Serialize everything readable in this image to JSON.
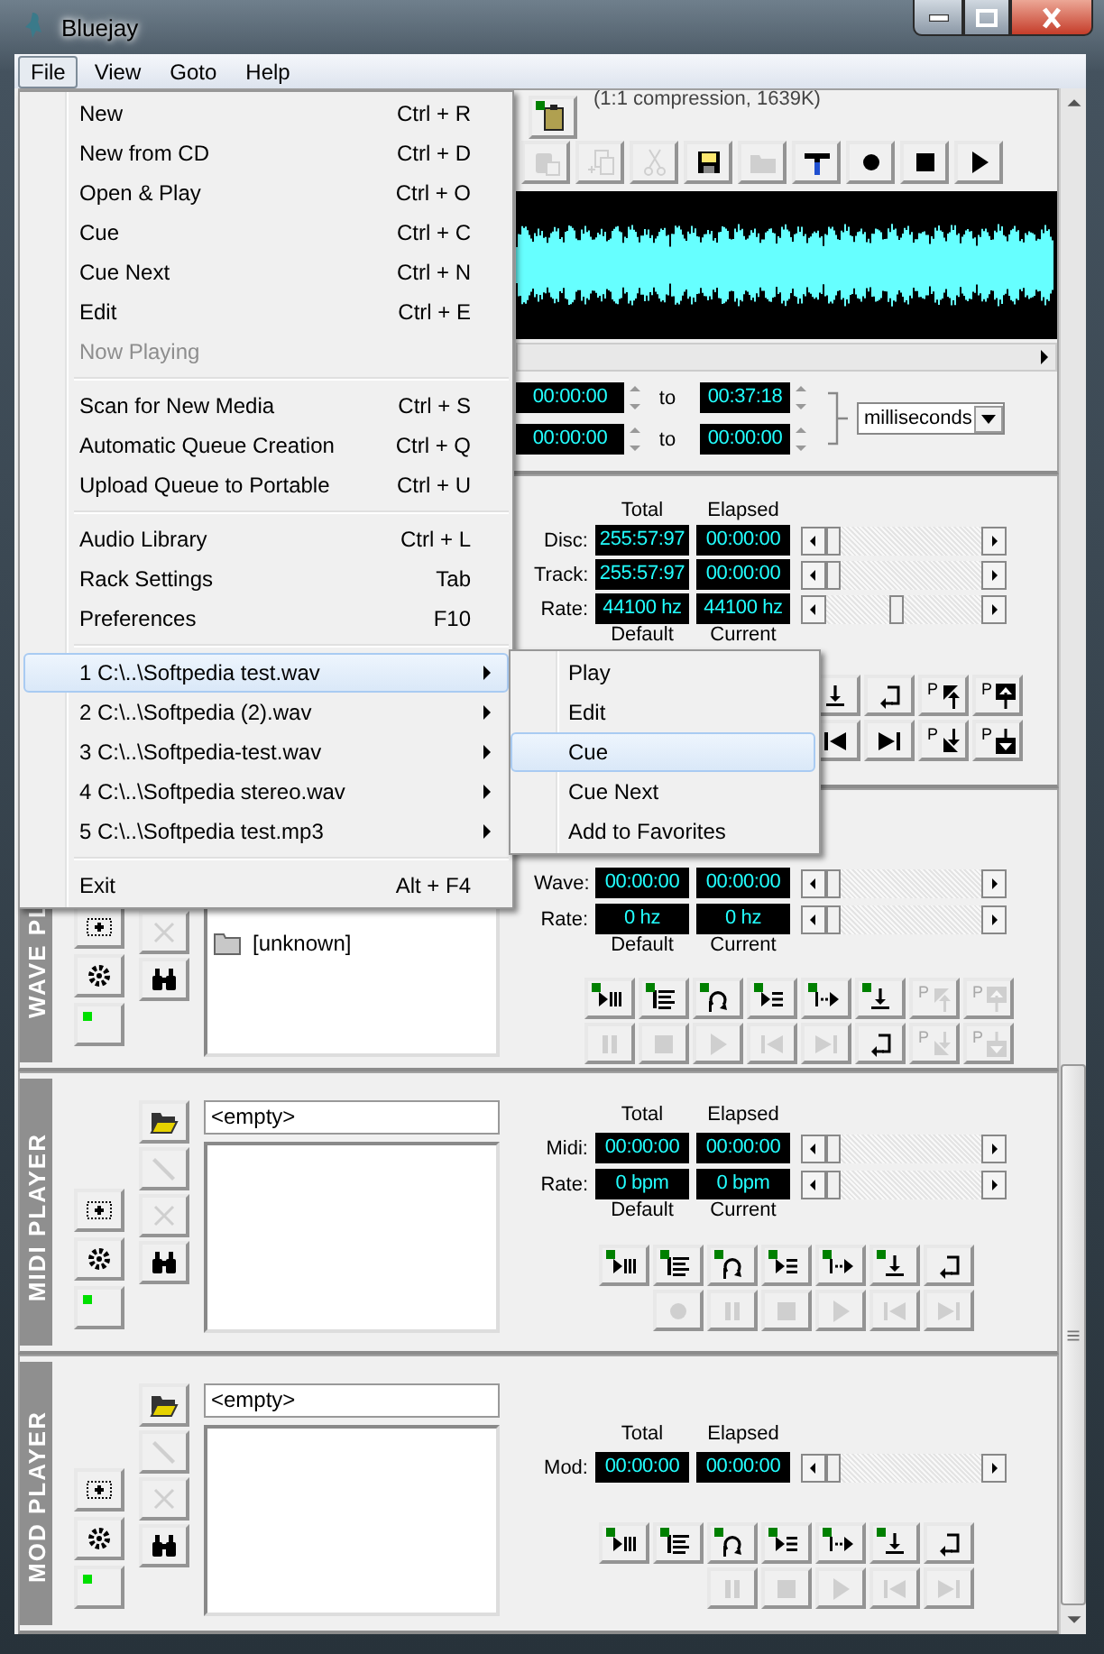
{
  "window": {
    "title": "Bluejay"
  },
  "menubar": [
    {
      "label": "File",
      "selected": true
    },
    {
      "label": "View",
      "selected": false
    },
    {
      "label": "Goto",
      "selected": false
    },
    {
      "label": "Help",
      "selected": false
    }
  ],
  "recorder": {
    "info": "(1:1 compression, 1639K)",
    "top_buttons": [
      {
        "kind": "clipboard",
        "disabled": false,
        "led": true
      }
    ],
    "tool_buttons": [
      {
        "kind": "paste",
        "disabled": true,
        "led": false
      },
      {
        "kind": "copy",
        "disabled": true,
        "led": false
      },
      {
        "kind": "scissors",
        "disabled": true,
        "led": false
      },
      {
        "kind": "floppy-disk",
        "disabled": false,
        "led": false
      },
      {
        "kind": "folder",
        "disabled": true,
        "led": false
      },
      {
        "kind": "hammer",
        "disabled": false,
        "led": false
      },
      {
        "kind": "record",
        "disabled": false,
        "led": false
      },
      {
        "kind": "stop",
        "disabled": false,
        "led": false
      },
      {
        "kind": "play",
        "disabled": false,
        "led": false
      }
    ],
    "ranges": [
      {
        "from": "00:00:00",
        "joiner": "to",
        "to": "00:37:18"
      },
      {
        "from": "00:00:00",
        "joiner": "to",
        "to": "00:00:00"
      }
    ],
    "unit": "milliseconds"
  },
  "players": [
    {
      "kind": "cd",
      "headers": [
        "Total",
        "Elapsed"
      ],
      "rows": [
        {
          "label": "Disc:",
          "total": "255:57:97",
          "elapsed": "00:00:00",
          "level": 0
        },
        {
          "label": "Track:",
          "total": "255:57:97",
          "elapsed": "00:00:00",
          "level": 0
        },
        {
          "label": "Rate:",
          "total": "44100 hz",
          "elapsed": "44100 hz",
          "level": 0.45
        }
      ],
      "footers": [
        "Default",
        "Current"
      ],
      "button_rows": [
        [
          {
            "kind": "arrow-down-bar",
            "disabled": false,
            "led": false
          },
          {
            "kind": "return-arrow",
            "disabled": false,
            "led": false
          },
          {
            "kind": "corner-up-arrow",
            "label": "P",
            "disabled": false,
            "led": false
          },
          {
            "kind": "filled-up-arrow",
            "label": "P",
            "disabled": false,
            "led": false
          }
        ],
        [
          {
            "kind": "skip-back",
            "disabled": false,
            "led": false
          },
          {
            "kind": "skip-forward",
            "disabled": false,
            "led": false
          },
          {
            "kind": "corner-down-arrow",
            "label": "P",
            "disabled": false,
            "led": false
          },
          {
            "kind": "filled-down-arrow",
            "label": "P",
            "disabled": false,
            "led": false
          }
        ]
      ]
    },
    {
      "kind": "wave",
      "title": "WAVE PL",
      "side_buttons": [
        {
          "kind": "dotted-plus",
          "disabled": false,
          "led": false
        },
        {
          "kind": "gear",
          "disabled": false,
          "led": false
        },
        {
          "kind": "indicator",
          "disabled": false,
          "led": true
        }
      ],
      "tool_buttons": [
        {
          "kind": "cross",
          "disabled": true,
          "led": false
        },
        {
          "kind": "binoculars",
          "disabled": false,
          "led": false
        }
      ],
      "list_items": [
        {
          "kind": "folder",
          "label": "[unknown]"
        }
      ],
      "rows": [
        {
          "label": "Wave:",
          "total": "00:00:00",
          "elapsed": "00:00:00",
          "level": 0
        },
        {
          "label": "Rate:",
          "total": "0 hz",
          "elapsed": "0 hz",
          "level": 0
        }
      ],
      "footers": [
        "Default",
        "Current"
      ],
      "button_rows": [
        [
          {
            "kind": "play-bars",
            "disabled": false,
            "led": true
          },
          {
            "kind": "list-lines",
            "disabled": false,
            "led": true
          },
          {
            "kind": "loop-arrows",
            "disabled": false,
            "led": true
          },
          {
            "kind": "play-list",
            "disabled": false,
            "led": true
          },
          {
            "kind": "step-play",
            "disabled": false,
            "led": true
          },
          {
            "kind": "arrow-down-bar",
            "disabled": false,
            "led": true
          },
          {
            "kind": "corner-up-arrow",
            "label": "P",
            "disabled": true,
            "led": false
          },
          {
            "kind": "filled-up-arrow",
            "label": "P",
            "disabled": true,
            "led": false
          }
        ],
        [
          {
            "kind": "pause",
            "disabled": true,
            "led": false
          },
          {
            "kind": "stop",
            "disabled": true,
            "led": false
          },
          {
            "kind": "play",
            "disabled": true,
            "led": false
          },
          {
            "kind": "skip-back",
            "disabled": true,
            "led": false
          },
          {
            "kind": "skip-forward",
            "disabled": true,
            "led": false
          },
          {
            "kind": "return-arrow",
            "disabled": false,
            "led": false
          },
          {
            "kind": "corner-down-arrow",
            "label": "P",
            "disabled": true,
            "led": false
          },
          {
            "kind": "filled-down-arrow",
            "label": "P",
            "disabled": true,
            "led": false
          }
        ]
      ]
    },
    {
      "kind": "midi",
      "title": "MIDI PLAYER",
      "side_buttons": [
        {
          "kind": "dotted-plus",
          "disabled": false,
          "led": false
        },
        {
          "kind": "gear",
          "disabled": false,
          "led": false
        },
        {
          "kind": "indicator",
          "disabled": false,
          "led": true
        }
      ],
      "tool_buttons": [
        {
          "kind": "folder-open",
          "disabled": false,
          "led": false
        },
        {
          "kind": "pencil",
          "disabled": true,
          "led": false
        },
        {
          "kind": "cross",
          "disabled": true,
          "led": false
        },
        {
          "kind": "binoculars",
          "disabled": false,
          "led": false
        }
      ],
      "field": "<empty>",
      "headers": [
        "Total",
        "Elapsed"
      ],
      "rows": [
        {
          "label": "Midi:",
          "total": "00:00:00",
          "elapsed": "00:00:00",
          "level": 0
        },
        {
          "label": "Rate:",
          "total": "0 bpm",
          "elapsed": "0 bpm",
          "level": 0
        }
      ],
      "footers": [
        "Default",
        "Current"
      ],
      "button_rows": [
        [
          {
            "kind": "play-bars",
            "disabled": false,
            "led": true
          },
          {
            "kind": "list-lines",
            "disabled": false,
            "led": true
          },
          {
            "kind": "loop-arrows",
            "disabled": false,
            "led": true
          },
          {
            "kind": "play-list",
            "disabled": false,
            "led": true
          },
          {
            "kind": "step-play",
            "disabled": false,
            "led": true
          },
          {
            "kind": "arrow-down-bar",
            "disabled": false,
            "led": true
          },
          {
            "kind": "return-arrow",
            "disabled": false,
            "led": false
          }
        ],
        [
          {
            "kind": "record",
            "disabled": true,
            "led": false
          },
          {
            "kind": "pause",
            "disabled": true,
            "led": false
          },
          {
            "kind": "stop",
            "disabled": true,
            "led": false
          },
          {
            "kind": "play",
            "disabled": true,
            "led": false
          },
          {
            "kind": "skip-back",
            "disabled": true,
            "led": false
          },
          {
            "kind": "skip-forward",
            "disabled": true,
            "led": false
          }
        ]
      ]
    },
    {
      "kind": "mod",
      "title": "MOD PLAYER",
      "side_buttons": [
        {
          "kind": "dotted-plus",
          "disabled": false,
          "led": false
        },
        {
          "kind": "gear",
          "disabled": false,
          "led": false
        },
        {
          "kind": "indicator",
          "disabled": false,
          "led": true
        }
      ],
      "tool_buttons": [
        {
          "kind": "folder-open",
          "disabled": false,
          "led": false
        },
        {
          "kind": "pencil",
          "disabled": true,
          "led": false
        },
        {
          "kind": "cross",
          "disabled": true,
          "led": false
        },
        {
          "kind": "binoculars",
          "disabled": false,
          "led": false
        }
      ],
      "field": "<empty>",
      "headers": [
        "Total",
        "Elapsed"
      ],
      "rows": [
        {
          "label": "Mod:",
          "total": "00:00:00",
          "elapsed": "00:00:00",
          "level": 0
        }
      ],
      "button_rows": [
        [
          {
            "kind": "play-bars",
            "disabled": false,
            "led": true
          },
          {
            "kind": "list-lines",
            "disabled": false,
            "led": true
          },
          {
            "kind": "loop-arrows",
            "disabled": false,
            "led": true
          },
          {
            "kind": "play-list",
            "disabled": false,
            "led": true
          },
          {
            "kind": "step-play",
            "disabled": false,
            "led": true
          },
          {
            "kind": "arrow-down-bar",
            "disabled": false,
            "led": true
          },
          {
            "kind": "return-arrow",
            "disabled": false,
            "led": false
          }
        ],
        [
          {
            "kind": "pause",
            "disabled": true,
            "led": false
          },
          {
            "kind": "stop",
            "disabled": true,
            "led": false
          },
          {
            "kind": "play",
            "disabled": true,
            "led": false
          },
          {
            "kind": "skip-back",
            "disabled": true,
            "led": false
          },
          {
            "kind": "skip-forward",
            "disabled": true,
            "led": false
          }
        ]
      ]
    }
  ],
  "file_menu": [
    {
      "kind": "item",
      "label": "New",
      "shortcut": "Ctrl + R",
      "disabled": false,
      "selected": false
    },
    {
      "kind": "item",
      "label": "New from CD",
      "shortcut": "Ctrl + D",
      "disabled": false,
      "selected": false
    },
    {
      "kind": "item",
      "label": "Open & Play",
      "shortcut": "Ctrl + O",
      "disabled": false,
      "selected": false
    },
    {
      "kind": "item",
      "label": "Cue",
      "shortcut": "Ctrl + C",
      "disabled": false,
      "selected": false
    },
    {
      "kind": "item",
      "label": "Cue Next",
      "shortcut": "Ctrl + N",
      "disabled": false,
      "selected": false
    },
    {
      "kind": "item",
      "label": "Edit",
      "shortcut": "Ctrl + E",
      "disabled": false,
      "selected": false
    },
    {
      "kind": "item",
      "label": "Now Playing",
      "disabled": true,
      "selected": false
    },
    {
      "kind": "separator"
    },
    {
      "kind": "item",
      "label": "Scan for New Media",
      "shortcut": "Ctrl + S",
      "disabled": false,
      "selected": false
    },
    {
      "kind": "item",
      "label": "Automatic Queue Creation",
      "shortcut": "Ctrl + Q",
      "disabled": false,
      "selected": false
    },
    {
      "kind": "item",
      "label": "Upload Queue to Portable",
      "shortcut": "Ctrl + U",
      "disabled": false,
      "selected": false
    },
    {
      "kind": "separator"
    },
    {
      "kind": "item",
      "label": "Audio Library",
      "shortcut": "Ctrl + L",
      "disabled": false,
      "selected": false
    },
    {
      "kind": "item",
      "label": "Rack Settings",
      "shortcut": "Tab",
      "disabled": false,
      "selected": false
    },
    {
      "kind": "item",
      "label": "Preferences",
      "shortcut": "F10",
      "disabled": false,
      "selected": false
    },
    {
      "kind": "separator"
    },
    {
      "kind": "submenu",
      "label": "1 C:\\..\\Softpedia test.wav",
      "disabled": false,
      "selected": true
    },
    {
      "kind": "submenu",
      "label": "2 C:\\..\\Softpedia (2).wav",
      "disabled": false,
      "selected": false
    },
    {
      "kind": "submenu",
      "label": "3 C:\\..\\Softpedia-test.wav",
      "disabled": false,
      "selected": false
    },
    {
      "kind": "submenu",
      "label": "4 C:\\..\\Softpedia stereo.wav",
      "disabled": false,
      "selected": false
    },
    {
      "kind": "submenu",
      "label": "5 C:\\..\\Softpedia test.mp3",
      "disabled": false,
      "selected": false
    },
    {
      "kind": "separator"
    },
    {
      "kind": "item",
      "label": "Exit",
      "shortcut": "Alt + F4",
      "disabled": false,
      "selected": false
    }
  ],
  "submenu": [
    {
      "label": "Play",
      "selected": false
    },
    {
      "label": "Edit",
      "selected": false
    },
    {
      "label": "Cue",
      "selected": true
    },
    {
      "label": "Cue Next",
      "selected": false
    },
    {
      "label": "Add to Favorites",
      "selected": false
    }
  ]
}
